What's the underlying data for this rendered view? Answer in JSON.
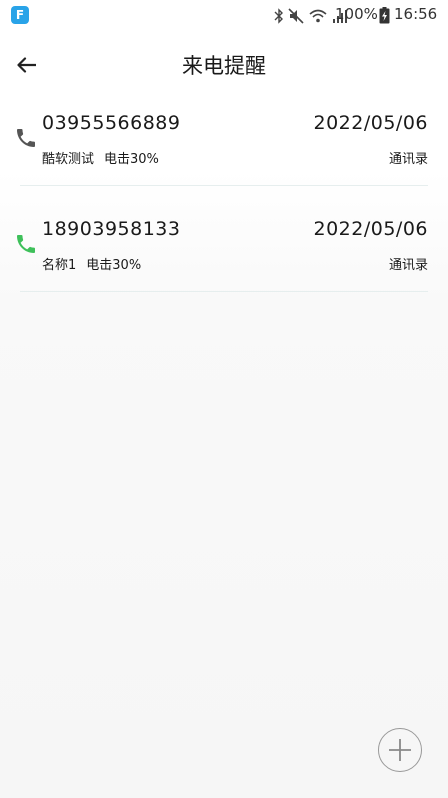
{
  "status_bar": {
    "app_badge": "F",
    "battery_percent": "100%",
    "time": "16:56",
    "icons": [
      "bluetooth-icon",
      "mute-icon",
      "wifi-icon",
      "signal-icon",
      "battery-charging-icon"
    ]
  },
  "header": {
    "title": "来电提醒",
    "back_icon": "back-arrow-icon"
  },
  "calls": [
    {
      "number": "03955566889",
      "date": "2022/05/06",
      "name": "酷软测试",
      "battery": "电击30%",
      "source": "通讯录",
      "icon_color": "#555555"
    },
    {
      "number": "18903958133",
      "date": "2022/05/06",
      "name": "名称1",
      "battery": "电击30%",
      "source": "通讯录",
      "icon_color": "#3ec05a"
    }
  ],
  "fab": {
    "icon": "plus-icon"
  },
  "colors": {
    "badge": "#29a3e8",
    "divider": "#e6eeee",
    "phone_gray": "#555555",
    "phone_green": "#3ec05a"
  }
}
